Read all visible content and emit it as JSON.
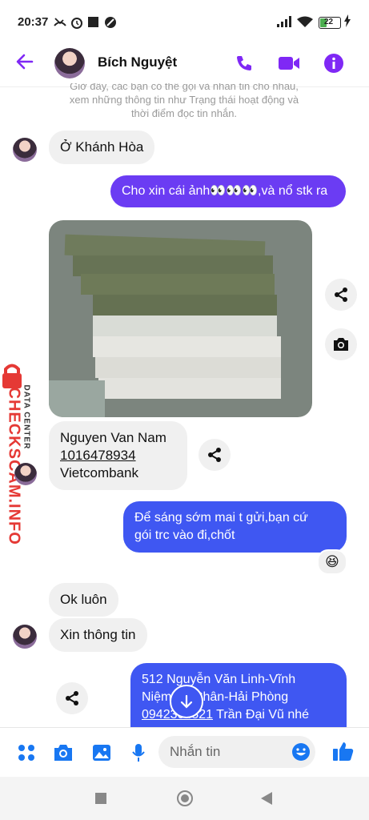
{
  "status_bar": {
    "time": "20:37",
    "battery": "22",
    "icons": [
      "missed-call-icon",
      "alarm-icon",
      "square-icon",
      "data-saver-icon",
      "signal-icon",
      "wifi-icon",
      "battery-icon",
      "charging-icon"
    ]
  },
  "header": {
    "contact_name": "Bích Nguyệt",
    "accent_color": "#7f28f5",
    "icons": [
      "back-arrow-icon",
      "phone-icon",
      "video-icon",
      "info-icon"
    ]
  },
  "notice": {
    "line1": "Giờ đây, các bạn có thể gọi và nhắn tin cho nhau,",
    "line2": "xem những thông tin như Trạng thái hoạt động và",
    "line3": "thời điểm đọc tin nhắn."
  },
  "messages": {
    "m1": "Ở Khánh Hòa",
    "m2": "Cho xin cái ảnh👀👀👀,và nổ stk ra",
    "m3_name": "Nguyen Van Nam",
    "m3_account": "1016478934",
    "m3_bank": "Vietcombank",
    "m4_line1": "Để sáng sớm mai t gửi,bạn cứ",
    "m4_line2": "gói trc vào đi,chốt",
    "m4_reaction": "😆",
    "m5": "Ok luôn",
    "m6": "Xin thông tin",
    "m7_line1": "512 Nguyễn Văn Linh-Vĩnh",
    "m7_line2": "Niệm-Lê Chân-Hải Phòng",
    "m7_phone": "0942304821",
    "m7_rest": " Trần Đại Vũ nhé"
  },
  "watermark": {
    "brand": "CHECKSCAM.INFO",
    "sub": "DATA CENTER"
  },
  "composer": {
    "placeholder": "Nhắn tin",
    "accent_color": "#1877f2",
    "icons": [
      "apps-icon",
      "camera-icon",
      "gallery-icon",
      "mic-icon",
      "emoji-icon",
      "thumbs-up-icon"
    ]
  },
  "navbar": {
    "icons": [
      "recents-square-icon",
      "home-circle-icon",
      "back-triangle-icon"
    ]
  }
}
